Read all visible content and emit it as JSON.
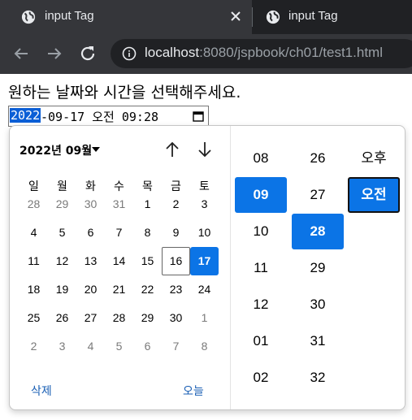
{
  "browser": {
    "tabs": [
      {
        "title": "input Tag",
        "active": true
      },
      {
        "title": "input Tag",
        "active": false
      }
    ],
    "url_host": "localhost",
    "url_rest": ":8080/jspbook/ch01/test1.html"
  },
  "page": {
    "prompt": "원하는 날짜와 시간을 선택해주세요.",
    "input": {
      "year": "2022",
      "rest": "-09-17 오전 09:28"
    }
  },
  "picker": {
    "month_label": "2022년 09월",
    "weekdays": [
      "일",
      "월",
      "화",
      "수",
      "목",
      "금",
      "토"
    ],
    "weeks": [
      [
        "28",
        "29",
        "30",
        "31",
        "1",
        "2",
        "3"
      ],
      [
        "4",
        "5",
        "6",
        "7",
        "8",
        "9",
        "10"
      ],
      [
        "11",
        "12",
        "13",
        "14",
        "15",
        "16",
        "17"
      ],
      [
        "18",
        "19",
        "20",
        "21",
        "22",
        "23",
        "24"
      ],
      [
        "25",
        "26",
        "27",
        "28",
        "29",
        "30",
        "1"
      ],
      [
        "2",
        "3",
        "4",
        "5",
        "6",
        "7",
        "8"
      ]
    ],
    "clear_label": "삭제",
    "today_label": "오늘",
    "hours": [
      "08",
      "09",
      "10",
      "11",
      "12",
      "01",
      "02"
    ],
    "minutes": [
      "26",
      "27",
      "28",
      "29",
      "30",
      "31",
      "32"
    ],
    "periods": [
      "오후",
      "오전"
    ],
    "selected_hour": "09",
    "selected_minute": "28",
    "selected_period": "오전",
    "selected_day": "17",
    "today_day": "16",
    "accent_color": "#0b74e6"
  }
}
